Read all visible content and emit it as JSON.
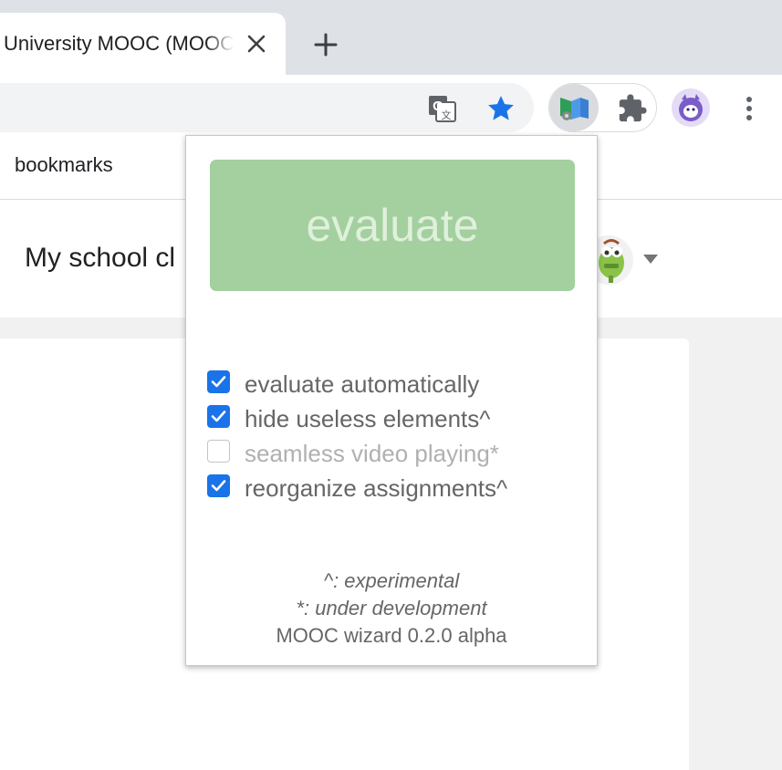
{
  "browser": {
    "tab": {
      "title": "University MOOC (MOOC)"
    },
    "bookmarks_bar": {
      "label": "bookmarks"
    },
    "icons": {
      "translate": "translate-icon",
      "bookmark": "star-icon",
      "extension": "mooc-wizard-icon",
      "extensions_menu": "puzzle-icon",
      "profile": "avatar",
      "menu": "kebab-menu-icon",
      "close": "close-icon",
      "new_tab": "plus-icon"
    },
    "colors": {
      "star": "#1a73e8",
      "tabstrip": "#dee1e6",
      "omnibox": "#f1f3f4"
    }
  },
  "page": {
    "title": "My school cl"
  },
  "popup": {
    "evaluate_label": "evaluate",
    "options": [
      {
        "label": "evaluate automatically",
        "checked": true,
        "enabled": true
      },
      {
        "label": "hide useless elements^",
        "checked": true,
        "enabled": true
      },
      {
        "label": "seamless video playing*",
        "checked": false,
        "enabled": false
      },
      {
        "label": "reorganize assignments^",
        "checked": true,
        "enabled": true
      }
    ],
    "footer": {
      "experimental": "^: experimental",
      "development": "*: under development",
      "version": "MOOC wizard 0.2.0 alpha"
    },
    "colors": {
      "button": "#a4cf9f",
      "button_text": "#dff0db",
      "checkbox": "#1a73e8"
    }
  }
}
